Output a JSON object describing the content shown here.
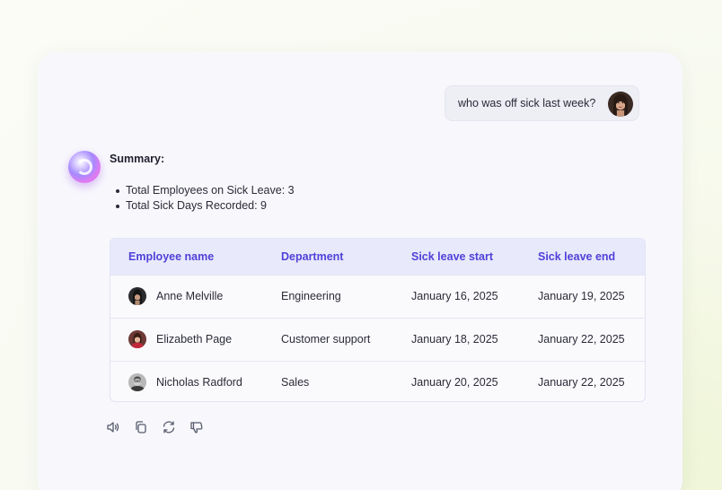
{
  "chat": {
    "user_message": "who was off sick last week?",
    "summary_title": "Summary:",
    "summary_items": [
      "Total Employees on Sick Leave: 3",
      "Total Sick Days Recorded: 9"
    ]
  },
  "table": {
    "headers": [
      "Employee name",
      "Department",
      "Sick leave start",
      "Sick leave end"
    ],
    "rows": [
      {
        "name": "Anne Melville",
        "department": "Engineering",
        "start": "January 16, 2025",
        "end": "January 19, 2025"
      },
      {
        "name": "Elizabeth Page",
        "department": "Customer support",
        "start": "January 18, 2025",
        "end": "January 22, 2025"
      },
      {
        "name": "Nicholas Radford",
        "department": "Sales",
        "start": "January 20, 2025",
        "end": "January 22, 2025"
      }
    ]
  },
  "actions": {
    "icons": [
      "speaker-icon",
      "copy-icon",
      "refresh-icon",
      "thumbs-down-icon"
    ]
  },
  "colors": {
    "header_text": "#5141d8",
    "header_bg": "#e8e9fb",
    "card_bg": "#f8f8fc"
  }
}
